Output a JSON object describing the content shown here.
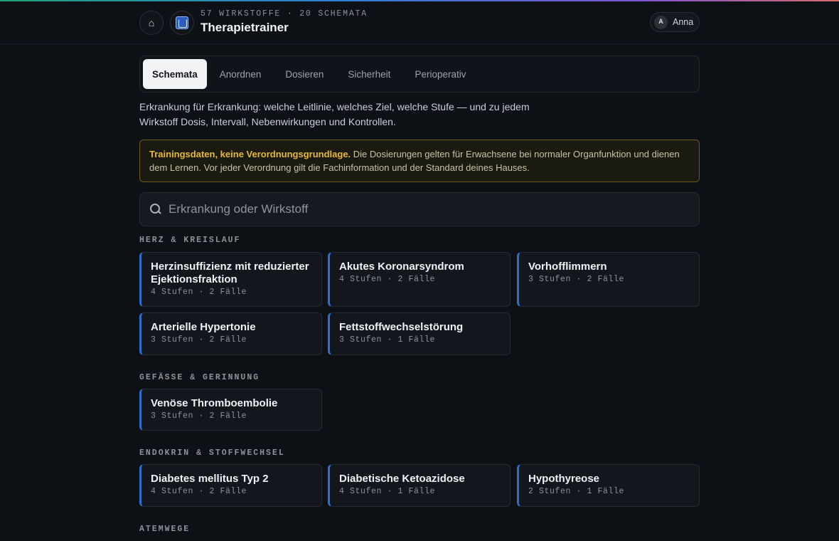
{
  "header": {
    "eyebrow": "57 WIRKSTOFFE · 20 SCHEMATA",
    "title": "Therapietrainer",
    "home_icon": "⌂",
    "user": {
      "initial": "A",
      "name": "Anna"
    }
  },
  "tabs": [
    {
      "label": "Schemata",
      "active": true
    },
    {
      "label": "Anordnen"
    },
    {
      "label": "Dosieren"
    },
    {
      "label": "Sicherheit"
    },
    {
      "label": "Perioperativ"
    }
  ],
  "intro": "Erkrankung für Erkrankung: welche Leitlinie, welches Ziel, welche Stufe — und zu jedem Wirkstoff Dosis, Intervall, Nebenwirkungen und Kontrollen.",
  "notice": {
    "strong": "Trainingsdaten, keine Verordnungsgrundlage.",
    "text": " Die Dosierungen gelten für Erwachsene bei normaler Organfunktion und dienen dem Lernen. Vor jeder Verordnung gilt die Fachinformation und der Standard deines Hauses."
  },
  "search": {
    "placeholder": "Erkrankung oder Wirkstoff",
    "value": ""
  },
  "sections": [
    {
      "title": "HERZ & KREISLAUF",
      "cards": [
        {
          "title": "Herzinsuffizienz mit reduzierter Ejektionsfraktion",
          "meta": "4 Stufen · 2 Fälle"
        },
        {
          "title": "Akutes Koronarsyndrom",
          "meta": "4 Stufen · 2 Fälle"
        },
        {
          "title": "Vorhofflimmern",
          "meta": "3 Stufen · 2 Fälle"
        },
        {
          "title": "Arterielle Hypertonie",
          "meta": "3 Stufen · 2 Fälle"
        },
        {
          "title": "Fettstoffwechselstörung",
          "meta": "3 Stufen · 1 Fälle"
        }
      ]
    },
    {
      "title": "GEFÄSSE & GERINNUNG",
      "cards": [
        {
          "title": "Venöse Thromboembolie",
          "meta": "3 Stufen · 2 Fälle"
        }
      ]
    },
    {
      "title": "ENDOKRIN & STOFFWECHSEL",
      "cards": [
        {
          "title": "Diabetes mellitus Typ 2",
          "meta": "4 Stufen · 2 Fälle"
        },
        {
          "title": "Diabetische Ketoazidose",
          "meta": "4 Stufen · 1 Fälle"
        },
        {
          "title": "Hypothyreose",
          "meta": "2 Stufen · 1 Fälle"
        }
      ]
    },
    {
      "title": "ATEMWEGE",
      "cards": []
    }
  ],
  "colors": {
    "accent": "#2f6fd0",
    "warning": "#e7b93a",
    "background": "#0d1014"
  }
}
